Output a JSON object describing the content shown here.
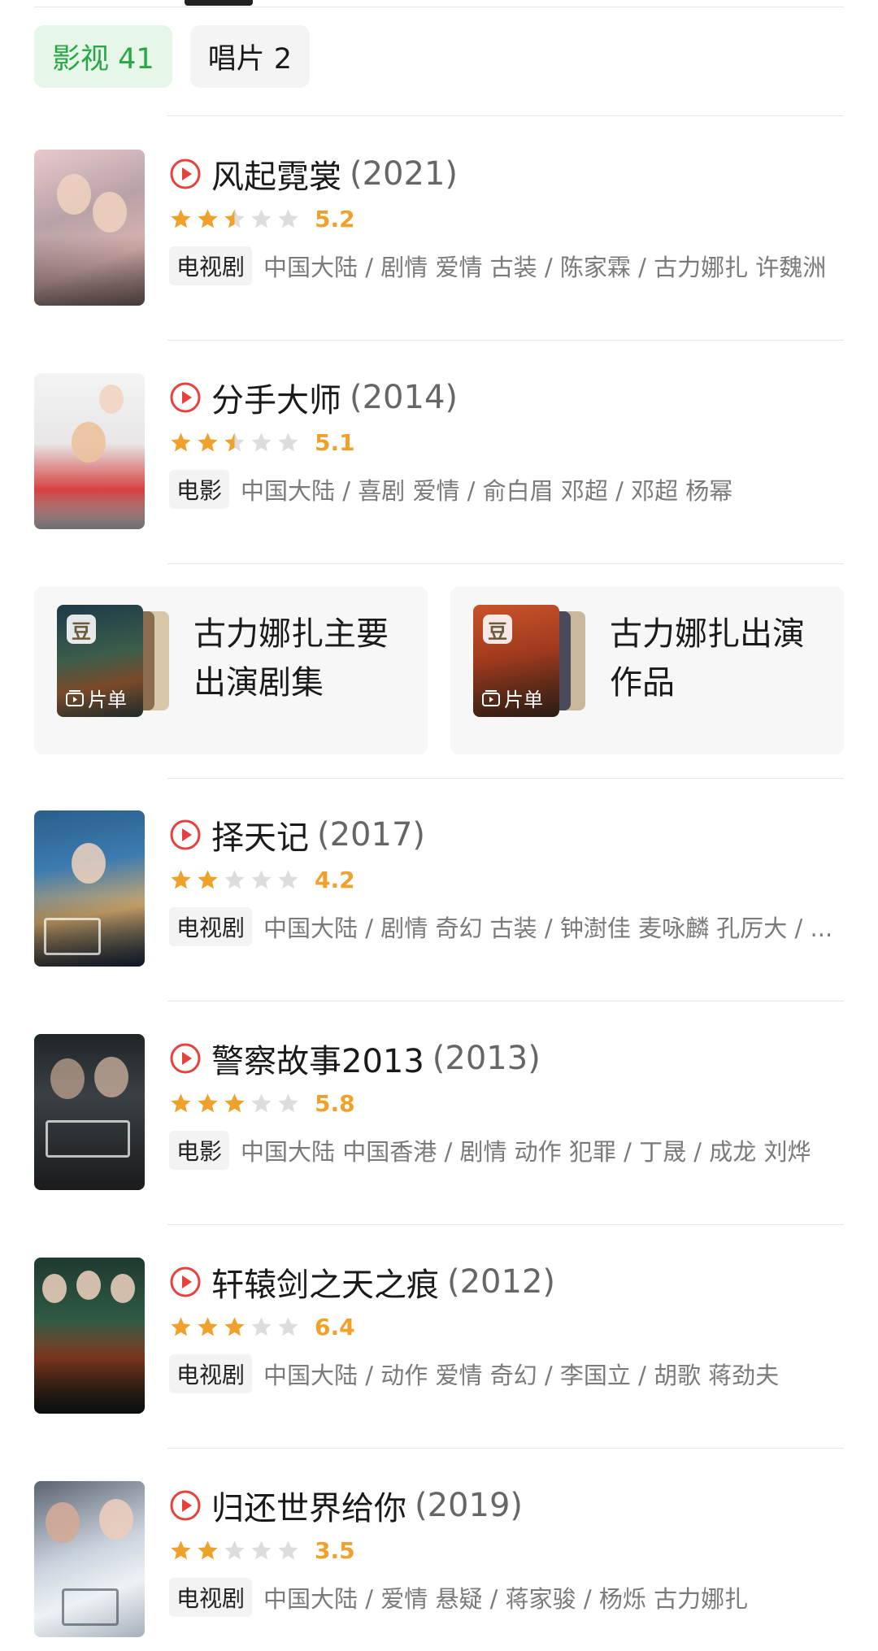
{
  "filters": [
    {
      "label": "影视 41",
      "active": true
    },
    {
      "label": "唱片 2",
      "active": false
    }
  ],
  "colors": {
    "accent_green": "#29a745",
    "star_filled": "#f0a12b",
    "star_empty": "#dddddd",
    "play_red": "#e8413c"
  },
  "items": [
    {
      "title": "风起霓裳",
      "year": "(2021)",
      "stars": 2.5,
      "score": "5.2",
      "type": "电视剧",
      "meta": "中国大陆 / 剧情 爱情 古装 / 陈家霖 / 古力娜扎 许魏洲"
    },
    {
      "title": "分手大师",
      "year": "(2014)",
      "stars": 2.5,
      "score": "5.1",
      "type": "电影",
      "meta": "中国大陆 / 喜剧 爱情 / 俞白眉 邓超 / 邓超 杨幂"
    },
    {
      "title": "择天记",
      "year": "(2017)",
      "stars": 2,
      "score": "4.2",
      "type": "电视剧",
      "meta": "中国大陆 / 剧情 奇幻 古装 / 钟澍佳 麦咏麟 孔厉大 / ..."
    },
    {
      "title": "警察故事2013",
      "year": "(2013)",
      "stars": 3,
      "score": "5.8",
      "type": "电影",
      "meta": "中国大陆 中国香港 / 剧情 动作 犯罪 / 丁晟 / 成龙 刘烨"
    },
    {
      "title": "轩辕剑之天之痕",
      "year": "(2012)",
      "stars": 3,
      "score": "6.4",
      "type": "电视剧",
      "meta": "中国大陆 / 动作 爱情 奇幻 / 李国立 / 胡歌 蒋劲夫"
    },
    {
      "title": "归还世界给你",
      "year": "(2019)",
      "stars": 2,
      "score": "3.5",
      "type": "电视剧",
      "meta": "中国大陆 / 爱情 悬疑 / 蒋家骏 / 杨烁 古力娜扎"
    }
  ],
  "lists": [
    {
      "title": "古力娜扎主要出演剧集",
      "badge": "豆",
      "tag": "片单"
    },
    {
      "title": "古力娜扎出演作品",
      "badge": "豆",
      "tag": "片单"
    }
  ]
}
